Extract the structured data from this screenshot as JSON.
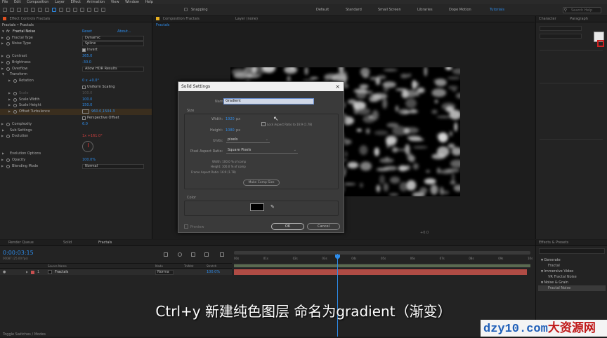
{
  "menubar": [
    "File",
    "Edit",
    "Composition",
    "Layer",
    "Effect",
    "Animation",
    "View",
    "Window",
    "Help"
  ],
  "toolbar": {
    "snapping": "Snapping",
    "workspaces": [
      "Default",
      "Standard",
      "Small Screen",
      "Libraries",
      "Dope Motion",
      "Tutorials"
    ],
    "search_placeholder": "Search Help"
  },
  "effect_controls": {
    "tab": "Effect Controls Fractals",
    "breadcrumb": "Fractals • Fractals",
    "fx_name": "Fractal Noise",
    "reset": "Reset",
    "about": "About...",
    "rows": [
      {
        "label": "Fractal Type",
        "value": "Dynamic",
        "kind": "dd"
      },
      {
        "label": "Noise Type",
        "value": "Spline",
        "kind": "dd"
      },
      {
        "label": "",
        "value": "Invert",
        "kind": "check"
      },
      {
        "label": "Contrast",
        "value": "365.0",
        "kind": "num"
      },
      {
        "label": "Brightness",
        "value": "-30.0",
        "kind": "num"
      },
      {
        "label": "Overflow",
        "value": "Allow HDR Results",
        "kind": "dd"
      },
      {
        "label": "Transform",
        "value": "",
        "kind": "group"
      },
      {
        "label": "Rotation",
        "value": "0 x +0.0°",
        "kind": "num"
      },
      {
        "label": "",
        "value": "Uniform Scaling",
        "kind": "check"
      },
      {
        "label": "Scale",
        "value": "100.0",
        "kind": "dim"
      },
      {
        "label": "Scale Width",
        "value": "100.0",
        "kind": "num"
      },
      {
        "label": "Scale Height",
        "value": "150.0",
        "kind": "num"
      },
      {
        "label": "Offset Turbulence",
        "value": "960.0,1504.3",
        "kind": "point"
      },
      {
        "label": "",
        "value": "Perspective Offset",
        "kind": "check"
      },
      {
        "label": "Complexity",
        "value": "6.0",
        "kind": "num"
      },
      {
        "label": "Sub Settings",
        "value": "",
        "kind": "group"
      },
      {
        "label": "Evolution",
        "value": "1x +161.0°",
        "kind": "red"
      },
      {
        "label": "Evolution Options",
        "value": "",
        "kind": "group2"
      },
      {
        "label": "Opacity",
        "value": "100.0%",
        "kind": "num"
      },
      {
        "label": "Blending Mode",
        "value": "Normal",
        "kind": "dd"
      }
    ]
  },
  "comp_panel": {
    "tab": "Composition Fractals",
    "layer_tab": "Layer (none)",
    "sub_tab": "Fractals",
    "bottom_bar": "+0.0"
  },
  "dialog": {
    "title": "Solid Settings",
    "name_label": "Name:",
    "name_value": "Gradient",
    "size_label": "Size",
    "width_label": "Width:",
    "width_value": "1920",
    "height_label": "Height:",
    "height_value": "1080",
    "px": "px",
    "lock_label": "Lock Aspect Ratio to 16:9 (1.78)",
    "units_label": "Units:",
    "units_value": "pixels",
    "par_label": "Pixel Aspect Ratio:",
    "par_value": "Square Pixels",
    "info_width": "Width:  100.0 % of comp",
    "info_height": "Height:  100.0 % of comp",
    "info_frame": "Frame Aspect Ratio:  16:9 (1.78)",
    "make_comp_size": "Make Comp Size",
    "color_label": "Color",
    "preview_label": "Preview",
    "ok": "OK",
    "cancel": "Cancel"
  },
  "right_panel": {
    "tabs": [
      "Character",
      "Paragraph"
    ]
  },
  "effects_presets": {
    "title": "Effects & Presets",
    "items": [
      {
        "label": "Generate",
        "level": 0
      },
      {
        "label": "Fractal",
        "level": 1
      },
      {
        "label": "Immersive Video",
        "level": 0
      },
      {
        "label": "VR Fractal Noise",
        "level": 1
      },
      {
        "label": "Noise & Grain",
        "level": 0
      },
      {
        "label": "Fractal Noise",
        "level": 1
      }
    ]
  },
  "timeline": {
    "tabs": [
      "Render Queue",
      "Solid",
      "Fractals"
    ],
    "timecode": "0:00:03:15",
    "fps": "00087 (25.00 fps)",
    "col_source": "Source Name",
    "col_mode": "Mode",
    "col_trkmat": "TrkMat",
    "col_stretch": "Stretch",
    "layer_num": "1",
    "layer_name": "Fractals",
    "layer_mode": "Norma",
    "layer_stretch": "100.0%",
    "ruler": [
      "00s",
      "01s",
      "02s",
      "03s",
      "04s",
      "05s",
      "06s",
      "07s",
      "08s",
      "09s",
      "10s"
    ],
    "toggle": "Toggle Switches / Modes"
  },
  "subtitle": "Ctrl+y 新建纯色图层 命名为gradient（渐变）",
  "watermark": {
    "latin": "dzy10.com",
    "cn": "大资源网"
  }
}
